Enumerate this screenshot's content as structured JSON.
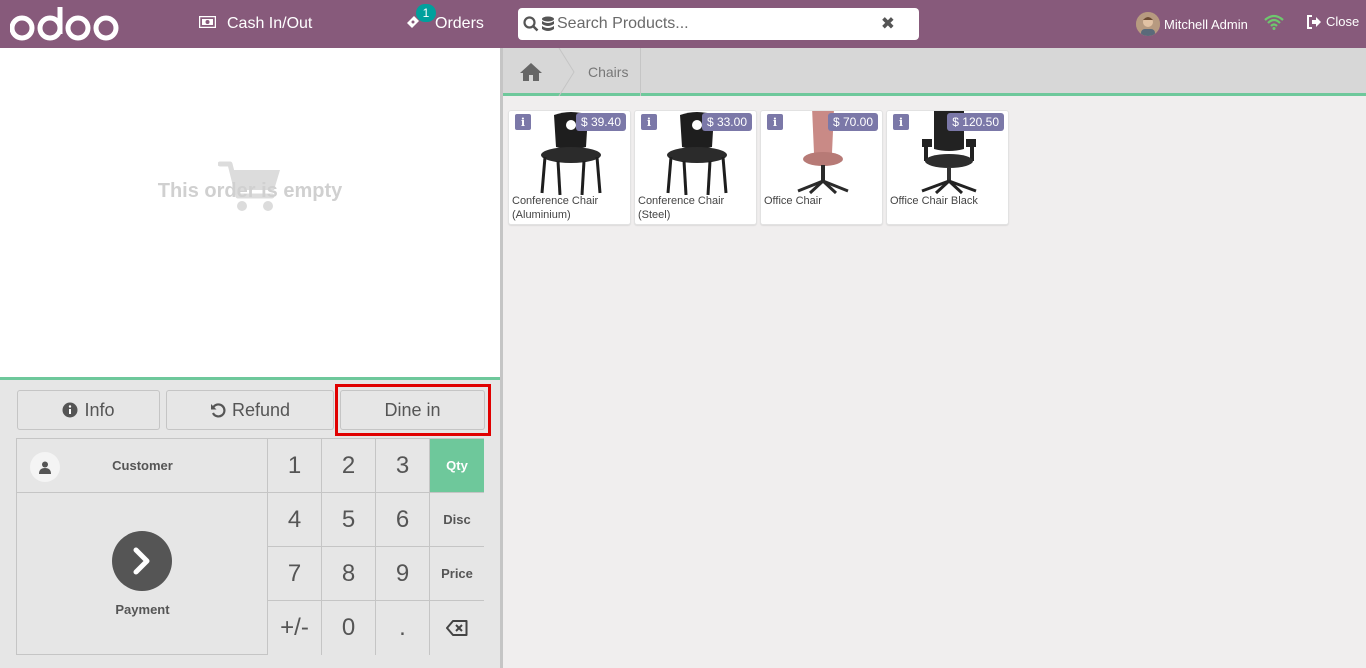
{
  "header": {
    "logo_text": "odoo",
    "cash_label": "Cash In/Out",
    "orders_label": "Orders",
    "orders_count": "1",
    "search_placeholder": "Search Products...",
    "user_name": "Mitchell Admin",
    "close_label": "Close"
  },
  "order": {
    "empty_text": "This order is empty"
  },
  "controls": {
    "info_label": "Info",
    "refund_label": "Refund",
    "dine_label": "Dine in"
  },
  "numpad": {
    "customer_label": "Customer",
    "payment_label": "Payment",
    "keys": [
      "1",
      "2",
      "3",
      "4",
      "5",
      "6",
      "7",
      "8",
      "9",
      "+/-",
      "0",
      "."
    ],
    "modes": [
      "Qty",
      "Disc",
      "Price"
    ],
    "active_mode": "Qty"
  },
  "breadcrumb": {
    "category": "Chairs"
  },
  "products": [
    {
      "name": "Conference Chair (Aluminium)",
      "price": "$ 39.40"
    },
    {
      "name": "Conference Chair (Steel)",
      "price": "$ 33.00"
    },
    {
      "name": "Office Chair",
      "price": "$ 70.00"
    },
    {
      "name": "Office Chair Black",
      "price": "$ 120.50"
    }
  ],
  "colors": {
    "brand": "#875a7b",
    "accent": "#6ec89b",
    "highlight": "#e00000",
    "price_badge": "#7b78a8"
  },
  "icons": [
    "money-icon",
    "ticket-icon",
    "search-icon",
    "database-icon",
    "clear-icon",
    "wifi-icon",
    "sign-out-icon",
    "cart-icon",
    "info-icon",
    "undo-icon",
    "user-icon",
    "chevron-right-icon",
    "backspace-icon",
    "home-icon"
  ]
}
